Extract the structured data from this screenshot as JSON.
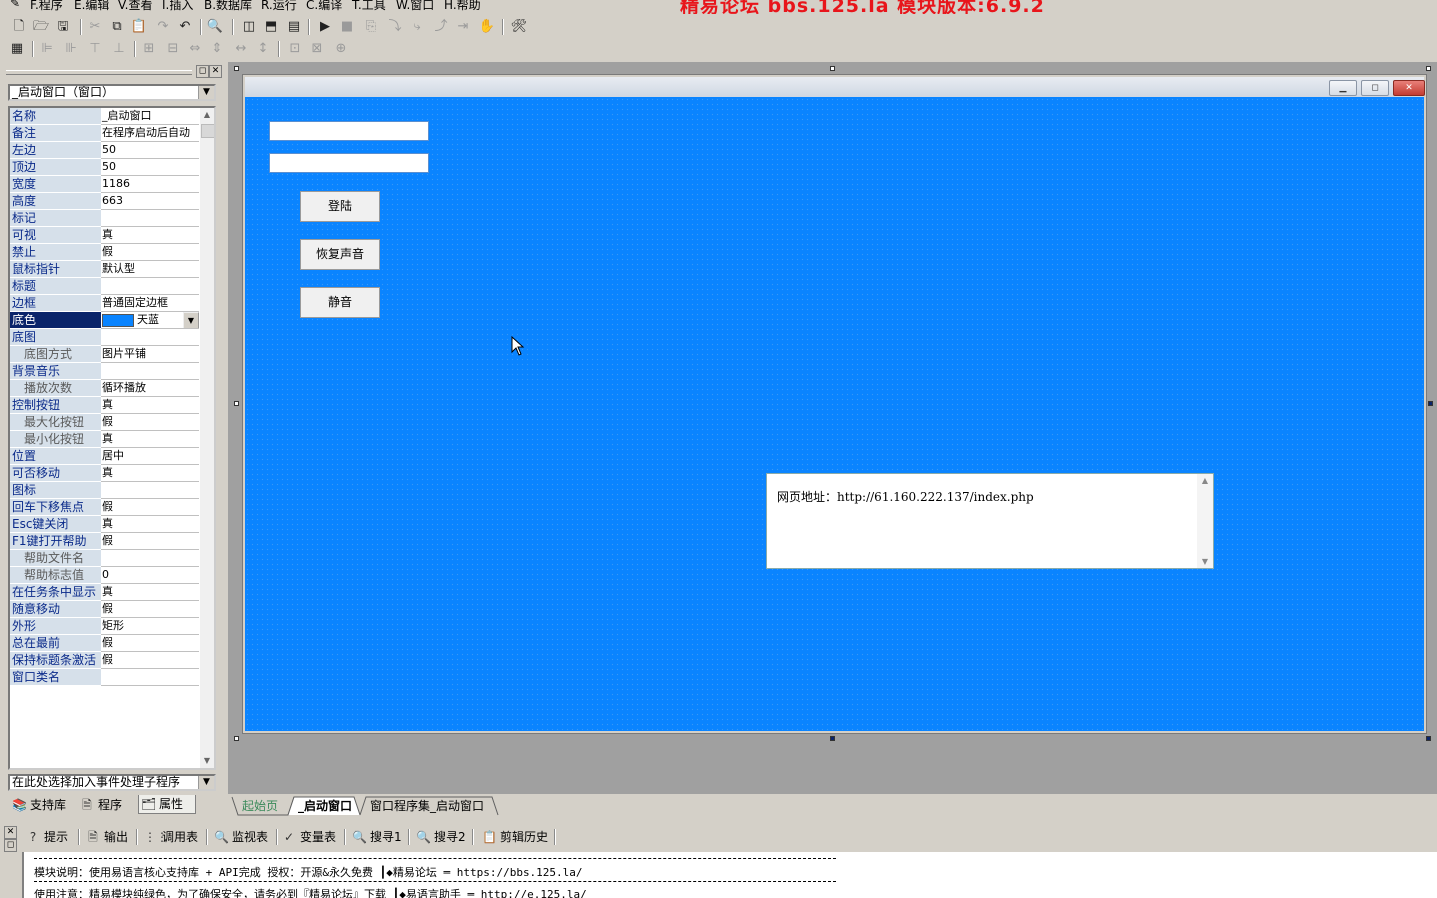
{
  "menu": [
    {
      "label": "F.程序"
    },
    {
      "label": "E.编辑"
    },
    {
      "label": "V.查看"
    },
    {
      "label": "I.插入"
    },
    {
      "label": "B.数据库"
    },
    {
      "label": "R.运行"
    },
    {
      "label": "C.编译"
    },
    {
      "label": "T.工具"
    },
    {
      "label": "W.窗口"
    },
    {
      "label": "H.帮助"
    }
  ],
  "banner": "精易论坛  bbs.125.la  模块版本:6.9.2",
  "left_panel": {
    "object_select": "_启动窗口（窗口）",
    "properties": [
      {
        "name": "名称",
        "value": "_启动窗口"
      },
      {
        "name": "备注",
        "value": "在程序启动后自动"
      },
      {
        "name": "左边",
        "value": "50"
      },
      {
        "name": "顶边",
        "value": "50"
      },
      {
        "name": "宽度",
        "value": "1186"
      },
      {
        "name": "高度",
        "value": "663"
      },
      {
        "name": "标记",
        "value": ""
      },
      {
        "name": "可视",
        "value": "真"
      },
      {
        "name": "禁止",
        "value": "假"
      },
      {
        "name": "鼠标指针",
        "value": "默认型"
      },
      {
        "name": "标题",
        "value": ""
      },
      {
        "name": "边框",
        "value": "普通固定边框"
      },
      {
        "name": "底色",
        "value": "天蓝"
      },
      {
        "name": "底图",
        "value": ""
      },
      {
        "name": "底图方式",
        "value": "图片平铺"
      },
      {
        "name": "背景音乐",
        "value": ""
      },
      {
        "name": "播放次数",
        "value": "循环播放"
      },
      {
        "name": "控制按钮",
        "value": "真"
      },
      {
        "name": "最大化按钮",
        "value": "假"
      },
      {
        "name": "最小化按钮",
        "value": "真"
      },
      {
        "name": "位置",
        "value": "居中"
      },
      {
        "name": "可否移动",
        "value": "真"
      },
      {
        "name": "图标",
        "value": ""
      },
      {
        "name": "回车下移焦点",
        "value": "假"
      },
      {
        "name": "Esc键关闭",
        "value": "真"
      },
      {
        "name": "F1键打开帮助",
        "value": "假"
      },
      {
        "name": "帮助文件名",
        "value": ""
      },
      {
        "name": "帮助标志值",
        "value": "0"
      },
      {
        "name": "在任务条中显示",
        "value": "真"
      },
      {
        "name": "随意移动",
        "value": "假"
      },
      {
        "name": "外形",
        "value": "矩形"
      },
      {
        "name": "总在最前",
        "value": "假"
      },
      {
        "name": "保持标题条激活",
        "value": "假"
      },
      {
        "name": "窗口类名",
        "value": ""
      }
    ],
    "event_select": "在此处选择加入事件处理子程序",
    "tabs": [
      {
        "label": "支持库"
      },
      {
        "label": "程序"
      },
      {
        "label": "属性"
      }
    ]
  },
  "form": {
    "buttons": [
      {
        "label": "登陆"
      },
      {
        "label": "恢复声音"
      },
      {
        "label": "静音"
      }
    ],
    "memo_text": "网页地址：http://61.160.222.137/index.php",
    "bg_color": "#0a84ff"
  },
  "editor_tabs": [
    {
      "label": "起始页"
    },
    {
      "label": "_启动窗口"
    },
    {
      "label": "窗口程序集_启动窗口"
    }
  ],
  "bottom_tabs": [
    {
      "label": "提示"
    },
    {
      "label": "输出"
    },
    {
      "label": "调用表"
    },
    {
      "label": "监视表"
    },
    {
      "label": "变量表"
    },
    {
      "label": "搜寻1"
    },
    {
      "label": "搜寻2"
    },
    {
      "label": "剪辑历史"
    }
  ],
  "output_lines": [
    "模块说明：使用易语言核心支持库 + API完成      授权：开源&永久免费  ┃◆精易论坛        ═  https://bbs.125.la/",
    "使用注意：精易模块纯绿色，为了确保安全，请务必到『精易论坛』下载  ┃◆易语言助手      ═  http://e.125.la/"
  ]
}
